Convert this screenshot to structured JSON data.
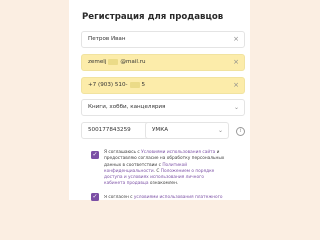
{
  "form": {
    "title": "Регистрация для продавцов",
    "name": {
      "value": "Петров Иван",
      "clear": "×"
    },
    "email": {
      "value_start": "zemelj",
      "value_end": "@mail.ru",
      "clear": "×"
    },
    "phone": {
      "value_start": "+7 (903) 510-",
      "value_end": "5",
      "clear": "×"
    },
    "category": {
      "value": "Книги, хобби, канцелярия",
      "chevron": "⌄"
    },
    "inn": {
      "value": "500177843259",
      "clear": "×"
    },
    "company": {
      "value": "УМКА",
      "chevron": "⌄"
    },
    "info_icon": "i",
    "consent1": {
      "check": "✓",
      "text_a": "Я соглашаюсь с ",
      "link_a": "Условиями использования сайта",
      "text_b": " и предоставляю согласие на обработку персональных данных в соответствии с ",
      "link_b": "Политикой конфиденциальности",
      "text_c": ". С ",
      "link_c": "Положением о порядке доступа и условиях использования личного кабинета продавца",
      "text_d": " ознакомлен."
    },
    "consent2": {
      "check": "✓",
      "text_a": "Я согласен с ",
      "link_a": "условиями использования платёжного"
    }
  }
}
